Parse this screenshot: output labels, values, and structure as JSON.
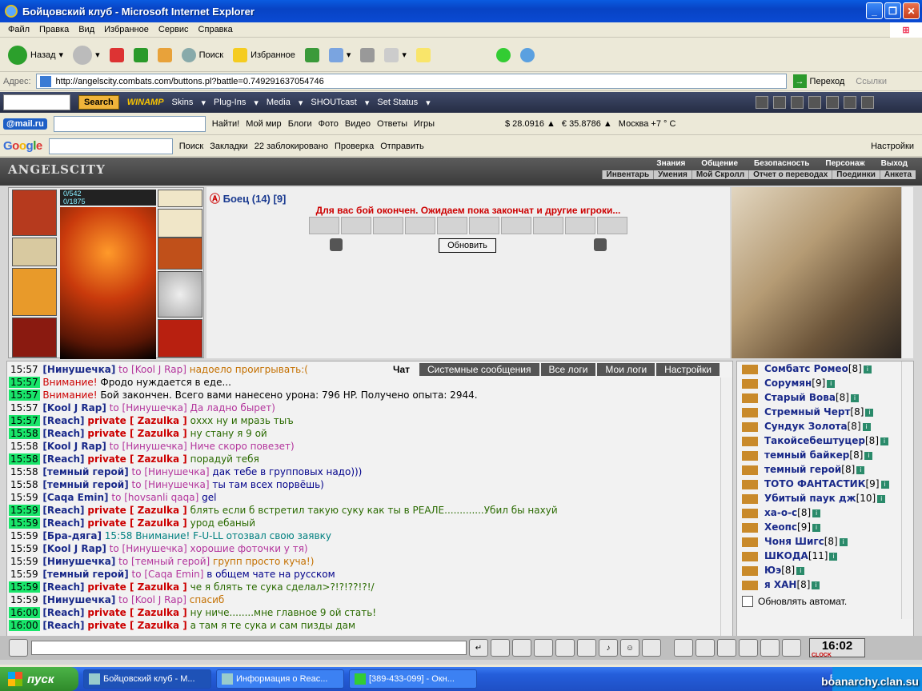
{
  "window": {
    "title": "Бойцовский клуб - Microsoft Internet Explorer"
  },
  "menu": [
    "Файл",
    "Правка",
    "Вид",
    "Избранное",
    "Сервис",
    "Справка"
  ],
  "toolbar": {
    "back": "Назад",
    "search": "Поиск",
    "favorites": "Избранное"
  },
  "address": {
    "label": "Адрес:",
    "url": "http://angelscity.combats.com/buttons.pl?battle=0.749291637054746",
    "go": "Переход",
    "links": "Ссылки"
  },
  "winamp": {
    "search_btn": "Search",
    "logo": "WINAMP",
    "skins": "Skins",
    "plugins": "Plug-Ins",
    "media": "Media",
    "shoutcast": "SHOUTcast",
    "status": "Set Status"
  },
  "mailru": {
    "logo": "@mail.ru",
    "find": "Найти!",
    "items": [
      "Мой мир",
      "Блоги",
      "Фото",
      "Видео",
      "Ответы",
      "Игры"
    ],
    "usd": "$ 28.0916 ▲",
    "eur": "€ 35.8786 ▲",
    "weather": "Москва +7 ° C"
  },
  "google": {
    "logo": "Google",
    "search": "Поиск",
    "bookmarks": "Закладки",
    "blocked": "22 заблокировано",
    "check": "Проверка",
    "send": "Отправить",
    "settings": "Настройки"
  },
  "site": {
    "logo": "ANGELSCITY",
    "topnav": [
      "Знания",
      "Общение",
      "Безопасность",
      "Персонаж",
      "Выход"
    ],
    "subnav": [
      "Инвентарь",
      "Умения",
      "Мой Скролл",
      "Отчет о переводах",
      "Поединки",
      "Анкета"
    ]
  },
  "character": {
    "hp": "0/542",
    "mp": "0/1875"
  },
  "battle": {
    "fighter": "Боец (14) [9]",
    "message": "Для вас бой окончен. Ожидаем пока закончат и другие игроки...",
    "refresh": "Обновить"
  },
  "chat": {
    "tabs": [
      "Чат",
      "Системные сообщения",
      "Все логи",
      "Мои логи",
      "Настройки"
    ],
    "lines": [
      {
        "t": "15:57",
        "hl": false,
        "nick": "[Нинушечка]",
        "to": "to [Kool J Rap]",
        "text": "надоело проигрывать:(",
        "c": "txt-o"
      },
      {
        "t": "15:57",
        "hl": true,
        "nick": "",
        "sys": "Внимание!",
        "text": "Фродо нуждается в еде...",
        "c": ""
      },
      {
        "t": "15:57",
        "hl": true,
        "nick": "",
        "sys": "Внимание!",
        "text": "Бой закончен. Всего вами нанесено урона: 796 HP. Получено опыта: 2944.",
        "c": ""
      },
      {
        "t": "15:57",
        "hl": false,
        "nick": "[Kool J Rap]",
        "to": "to [Нинушечка]",
        "text": "Да ладно бырет)",
        "c": "txt-p"
      },
      {
        "t": "15:57",
        "hl": true,
        "nick": "[Reach]",
        "priv": "private [ Zazulka ]",
        "text": "охxх ну и мразь тыъ",
        "c": "txt-g"
      },
      {
        "t": "15:58",
        "hl": true,
        "nick": "[Reach]",
        "priv": "private [ Zazulka ]",
        "text": "ну стану я 9 ой",
        "c": "txt-g"
      },
      {
        "t": "15:58",
        "hl": false,
        "nick": "[Kool J Rap]",
        "to": "to [Нинушечка]",
        "text": "Ниче скоро повезет)",
        "c": "txt-p"
      },
      {
        "t": "15:58",
        "hl": true,
        "nick": "[Reach]",
        "priv": "private [ Zazulka ]",
        "text": "порадуй тебя",
        "c": "txt-g"
      },
      {
        "t": "15:58",
        "hl": false,
        "nick": "[темный герой]",
        "to": "to [Нинушечка]",
        "text": "дак тебе в групповых надо)))",
        "c": "txt-b"
      },
      {
        "t": "15:58",
        "hl": false,
        "nick": "[темный герой]",
        "to": "to [Нинушечка]",
        "text": "ты там всех порвёшь)",
        "c": "txt-b"
      },
      {
        "t": "15:59",
        "hl": false,
        "nick": "[Caqa Emin]",
        "to": "to [hovsanli qaqa]",
        "text": "gel",
        "c": "txt-b"
      },
      {
        "t": "15:59",
        "hl": true,
        "nick": "[Reach]",
        "priv": "private [ Zazulka ]",
        "text": "блять если б встретил такую суку как ты в РЕАЛЕ.............Убил бы нахуй",
        "c": "txt-g"
      },
      {
        "t": "15:59",
        "hl": true,
        "nick": "[Reach]",
        "priv": "private [ Zazulka ]",
        "text": "урод ебаный",
        "c": "txt-g"
      },
      {
        "t": "15:59",
        "hl": false,
        "nick": "[Бра-дяга]",
        "to": "",
        "text": "15:58 Внимание! F-U-LL отозвал свою заявку",
        "c": "txt-t"
      },
      {
        "t": "15:59",
        "hl": false,
        "nick": "[Kool J Rap]",
        "to": "to [Нинушечка]",
        "text": "хорошие фоточки у тя)",
        "c": "txt-p"
      },
      {
        "t": "15:59",
        "hl": false,
        "nick": "[Нинушечка]",
        "to": "to [темный герой]",
        "text": "групп просто куча!)",
        "c": "txt-o"
      },
      {
        "t": "15:59",
        "hl": false,
        "nick": "[темный герой]",
        "to": "to [Caqa Emin]",
        "text": "в общем чате на русском",
        "c": "txt-b"
      },
      {
        "t": "15:59",
        "hl": true,
        "nick": "[Reach]",
        "priv": "private [ Zazulka ]",
        "text": "че я блять те сука сделал>?!?!??!?!/",
        "c": "txt-g"
      },
      {
        "t": "15:59",
        "hl": false,
        "nick": "[Нинушечка]",
        "to": "to [Kool J Rap]",
        "text": "спасиб",
        "c": "txt-o"
      },
      {
        "t": "16:00",
        "hl": true,
        "nick": "[Reach]",
        "priv": "private [ Zazulka ]",
        "text": "ну ниче........мне главное 9 ой стать!",
        "c": "txt-g"
      },
      {
        "t": "16:00",
        "hl": true,
        "nick": "[Reach]",
        "priv": "private [ Zazulka ]",
        "text": "а там я те сука и сам пизды дам",
        "c": "txt-g"
      }
    ]
  },
  "users": {
    "list": [
      {
        "name": "Сомбатс Ромео",
        "lvl": "[8]"
      },
      {
        "name": "Сорумян",
        "lvl": "[9]"
      },
      {
        "name": "Старый Вова",
        "lvl": "[8]"
      },
      {
        "name": "Стремный Черт",
        "lvl": "[8]"
      },
      {
        "name": "Сундук Золота",
        "lvl": "[8]"
      },
      {
        "name": "Такойсебештуцер",
        "lvl": "[8]"
      },
      {
        "name": "темный байкер",
        "lvl": "[8]"
      },
      {
        "name": "темный герой",
        "lvl": "[8]"
      },
      {
        "name": "ТОТО ФАНТАСТИК",
        "lvl": "[9]"
      },
      {
        "name": "Убитый паук дж",
        "lvl": "[10]"
      },
      {
        "name": "ха-о-с",
        "lvl": "[8]"
      },
      {
        "name": "Хеопс",
        "lvl": "[9]"
      },
      {
        "name": "Чоня Шигс",
        "lvl": "[8]"
      },
      {
        "name": "ШКОДА",
        "lvl": "[11]"
      },
      {
        "name": "Юэ",
        "lvl": "[8]"
      },
      {
        "name": "я ХАН",
        "lvl": "[8]"
      }
    ],
    "auto_update": "Обновлять автомат."
  },
  "bottom": {
    "clock": "16:02",
    "clock_label": "CLOCK"
  },
  "taskbar": {
    "start": "пуск",
    "tasks": [
      "Бойцовский клуб - M...",
      "Информация о Reac...",
      "[389-433-099] - Окн..."
    ],
    "lang": "EN",
    "watermark": "boanarchy.clan.su"
  }
}
